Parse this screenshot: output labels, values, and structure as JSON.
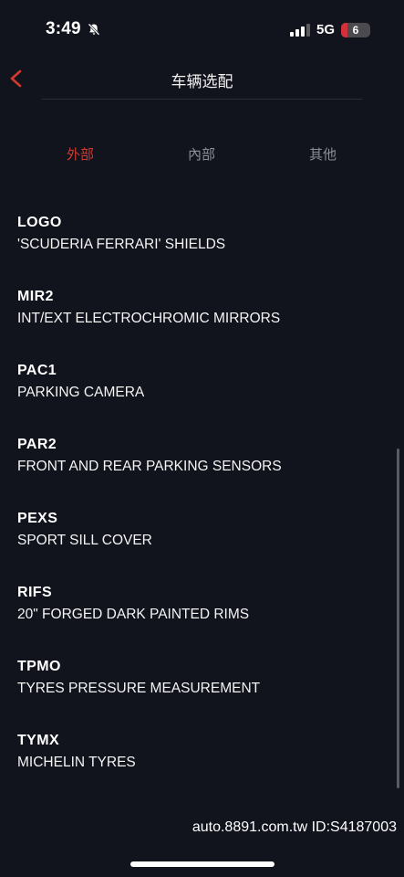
{
  "status_bar": {
    "time": "3:49",
    "network": "5G",
    "battery": "6"
  },
  "header": {
    "title": "车辆选配"
  },
  "tabs": [
    {
      "label": "外部",
      "active": true
    },
    {
      "label": "內部",
      "active": false
    },
    {
      "label": "其他",
      "active": false
    }
  ],
  "options": [
    {
      "code": "LOGO",
      "description": "'SCUDERIA FERRARI' SHIELDS"
    },
    {
      "code": "MIR2",
      "description": "INT/EXT ELECTROCHROMIC MIRRORS"
    },
    {
      "code": "PAC1",
      "description": "PARKING CAMERA"
    },
    {
      "code": "PAR2",
      "description": "FRONT AND REAR PARKING SENSORS"
    },
    {
      "code": "PEXS",
      "description": "SPORT SILL COVER"
    },
    {
      "code": "RIFS",
      "description": "20\" FORGED DARK PAINTED RIMS"
    },
    {
      "code": "TPMO",
      "description": "TYRES PRESSURE MEASUREMENT"
    },
    {
      "code": "TYMX",
      "description": "MICHELIN TYRES"
    }
  ],
  "watermark": "auto.8891.com.tw   ID:S4187003",
  "colors": {
    "background": "#11131d",
    "accent": "#d23a2e",
    "inactive_tab": "#8d8f96"
  }
}
